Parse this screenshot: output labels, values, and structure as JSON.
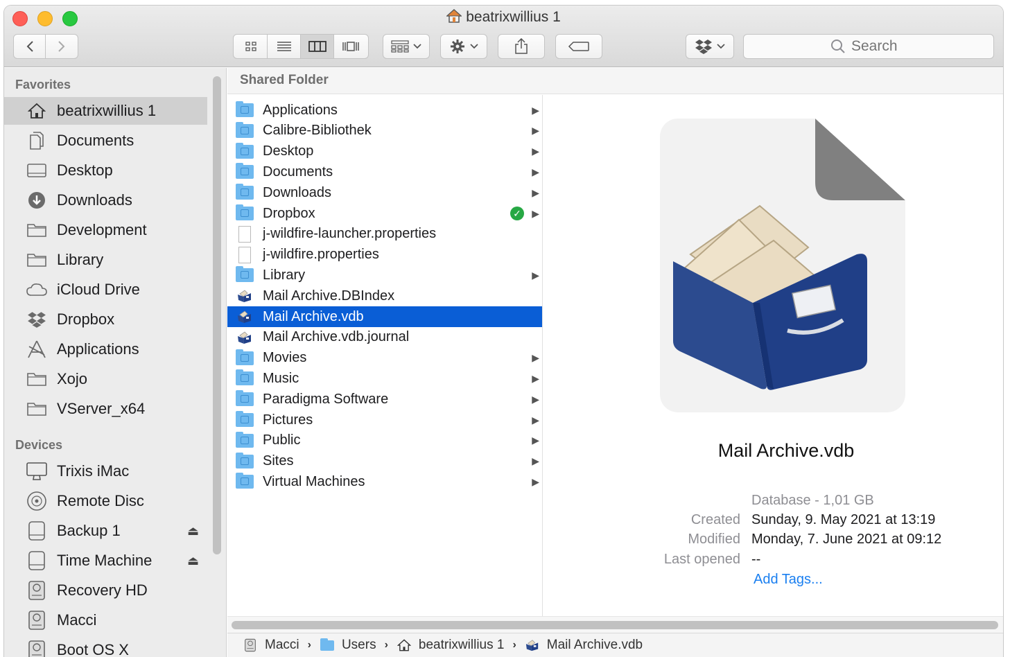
{
  "window": {
    "title": "beatrixwillius 1"
  },
  "toolbar": {
    "view_modes": [
      "icon",
      "list",
      "column",
      "gallery"
    ],
    "active_view": "column",
    "search_placeholder": "Search"
  },
  "sidebar": {
    "favorites_heading": "Favorites",
    "favorites": [
      {
        "label": "beatrixwillius 1",
        "icon": "home-icon",
        "selected": true
      },
      {
        "label": "Documents",
        "icon": "documents-icon"
      },
      {
        "label": "Desktop",
        "icon": "desktop-icon"
      },
      {
        "label": "Downloads",
        "icon": "downloads-icon"
      },
      {
        "label": "Development",
        "icon": "folder-icon"
      },
      {
        "label": "Library",
        "icon": "folder-icon"
      },
      {
        "label": "iCloud Drive",
        "icon": "cloud-icon"
      },
      {
        "label": "Dropbox",
        "icon": "dropbox-icon"
      },
      {
        "label": "Applications",
        "icon": "applications-icon"
      },
      {
        "label": "Xojo",
        "icon": "folder-icon"
      },
      {
        "label": "VServer_x64",
        "icon": "folder-icon"
      }
    ],
    "devices_heading": "Devices",
    "devices": [
      {
        "label": "Trixis iMac",
        "icon": "imac-icon"
      },
      {
        "label": "Remote Disc",
        "icon": "disc-icon"
      },
      {
        "label": "Backup 1",
        "icon": "drive-icon",
        "eject": true
      },
      {
        "label": "Time Machine",
        "icon": "drive-icon",
        "eject": true
      },
      {
        "label": "Recovery HD",
        "icon": "hd-icon"
      },
      {
        "label": "Macci",
        "icon": "hd-icon"
      },
      {
        "label": "Boot OS X",
        "icon": "hd-icon"
      }
    ]
  },
  "column_header": "Shared Folder",
  "files": [
    {
      "name": "Applications",
      "type": "folder",
      "arrow": true
    },
    {
      "name": "Calibre-Bibliothek",
      "type": "folder",
      "arrow": true
    },
    {
      "name": "Desktop",
      "type": "folder",
      "arrow": true
    },
    {
      "name": "Documents",
      "type": "folder",
      "arrow": true
    },
    {
      "name": "Downloads",
      "type": "folder",
      "arrow": true
    },
    {
      "name": "Dropbox",
      "type": "folder",
      "arrow": true,
      "synced": true
    },
    {
      "name": "j-wildfire-launcher.properties",
      "type": "doc"
    },
    {
      "name": "j-wildfire.properties",
      "type": "doc"
    },
    {
      "name": "Library",
      "type": "folder",
      "arrow": true
    },
    {
      "name": "Mail Archive.DBIndex",
      "type": "archive"
    },
    {
      "name": "Mail Archive.vdb",
      "type": "archive",
      "selected": true
    },
    {
      "name": "Mail Archive.vdb.journal",
      "type": "archive"
    },
    {
      "name": "Movies",
      "type": "folder",
      "arrow": true
    },
    {
      "name": "Music",
      "type": "folder",
      "arrow": true
    },
    {
      "name": "Paradigma Software",
      "type": "folder",
      "arrow": true
    },
    {
      "name": "Pictures",
      "type": "folder",
      "arrow": true
    },
    {
      "name": "Public",
      "type": "folder",
      "arrow": true
    },
    {
      "name": "Sites",
      "type": "folder",
      "arrow": true
    },
    {
      "name": "Virtual Machines",
      "type": "folder",
      "arrow": true
    }
  ],
  "preview": {
    "name": "Mail Archive.vdb",
    "kind": "Database - 1,01 GB",
    "created_label": "Created",
    "created": "Sunday, 9. May 2021 at 13:19",
    "modified_label": "Modified",
    "modified": "Monday, 7. June 2021 at 09:12",
    "last_opened_label": "Last opened",
    "last_opened": "--",
    "add_tags": "Add Tags..."
  },
  "path_bar": [
    {
      "label": "Macci",
      "icon": "hd-icon"
    },
    {
      "label": "Users",
      "icon": "folder-icon"
    },
    {
      "label": "beatrixwillius 1",
      "icon": "home-icon"
    },
    {
      "label": "Mail Archive.vdb",
      "icon": "archive-icon"
    }
  ],
  "colors": {
    "selection": "#0a5ed6",
    "folder": "#6fb9ef",
    "link": "#1a7ff0",
    "sync_ok": "#27a844"
  }
}
